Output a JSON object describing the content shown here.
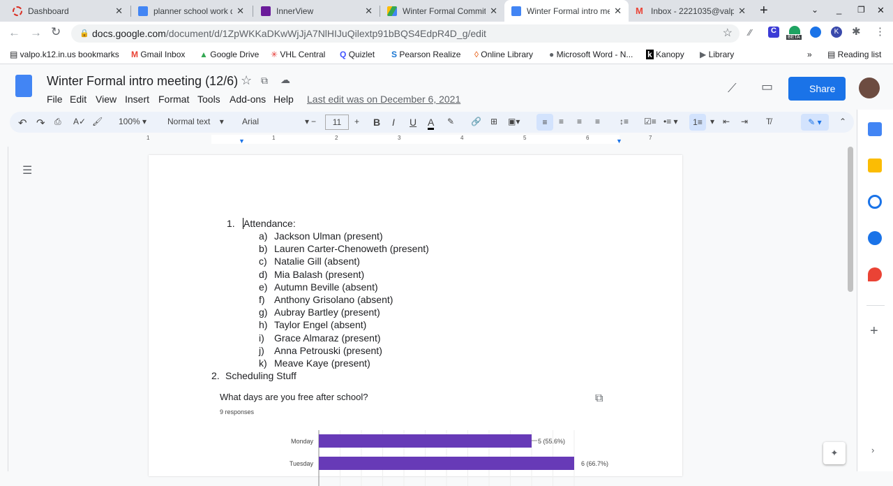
{
  "browser": {
    "tabs": [
      {
        "title": "Dashboard",
        "icon": "dashboard-icon",
        "color": "#d93025"
      },
      {
        "title": "planner school work do",
        "icon": "docs-icon",
        "color": "#4285f4"
      },
      {
        "title": "InnerView",
        "icon": "innerview-icon",
        "color": "#6a1b9a"
      },
      {
        "title": "Winter Formal Commit",
        "icon": "drive-icon",
        "color": "#fbbc04"
      },
      {
        "title": "Winter Formal intro me",
        "icon": "docs-icon",
        "color": "#4285f4",
        "active": true
      },
      {
        "title": "Inbox - 2221035@valpo",
        "icon": "gmail-icon",
        "color": "#ea4335"
      }
    ],
    "url_host": "docs.google.com",
    "url_path": "/document/d/1ZpWKKaDKwWjJjA7NlHIJuQilextp91bBQS4EdpR4D_g/edit",
    "bookmarks": [
      "valpo.k12.in.us bookmarks",
      "Gmail Inbox",
      "Google Drive",
      "VHL Central",
      "Quizlet",
      "Pearson Realize",
      "Online Library",
      "Microsoft Word - N...",
      "Kanopy",
      "Library"
    ],
    "reading_list": "Reading list",
    "beta_badge": "BETA"
  },
  "doc": {
    "title": "Winter Formal intro meeting (12/6)",
    "menu": [
      "File",
      "Edit",
      "View",
      "Insert",
      "Format",
      "Tools",
      "Add-ons",
      "Help"
    ],
    "last_edit": "Last edit was on December 6, 2021",
    "share": "Share",
    "zoom": "100%",
    "style": "Normal text",
    "font": "Arial",
    "font_size": "11",
    "ruler_marks": [
      "1",
      "1",
      "2",
      "3",
      "4",
      "5",
      "6",
      "7"
    ]
  },
  "content": {
    "item1": "Attendance:",
    "item1_num": "1.",
    "attendance": [
      [
        "a)",
        "Jackson Ulman (present)"
      ],
      [
        "b)",
        "Lauren Carter-Chenoweth (present)"
      ],
      [
        "c)",
        "Natalie Gill (absent)"
      ],
      [
        "d)",
        "Mia Balash (present)"
      ],
      [
        "e)",
        "Autumn Beville (absent)"
      ],
      [
        "f)",
        "Anthony Grisolano (absent)"
      ],
      [
        "g)",
        "Aubray Bartley (present)"
      ],
      [
        "h)",
        "Taylor Engel (absent)"
      ],
      [
        "i)",
        "Grace Almaraz (present)"
      ],
      [
        "j)",
        "Anna Petrouski (present)"
      ],
      [
        "k)",
        "Meave Kaye (present)"
      ]
    ],
    "item2_num": "2.",
    "item2": "Scheduling Stuff"
  },
  "chart_data": {
    "type": "bar",
    "orientation": "horizontal",
    "title": "What days are you free after school?",
    "subtitle": "9 responses",
    "categories": [
      "Monday",
      "Tuesday"
    ],
    "values": [
      5,
      6
    ],
    "data_labels": [
      "5 (55.6%)",
      "6 (66.7%)"
    ],
    "bar_color": "#673ab7",
    "grid": true
  }
}
